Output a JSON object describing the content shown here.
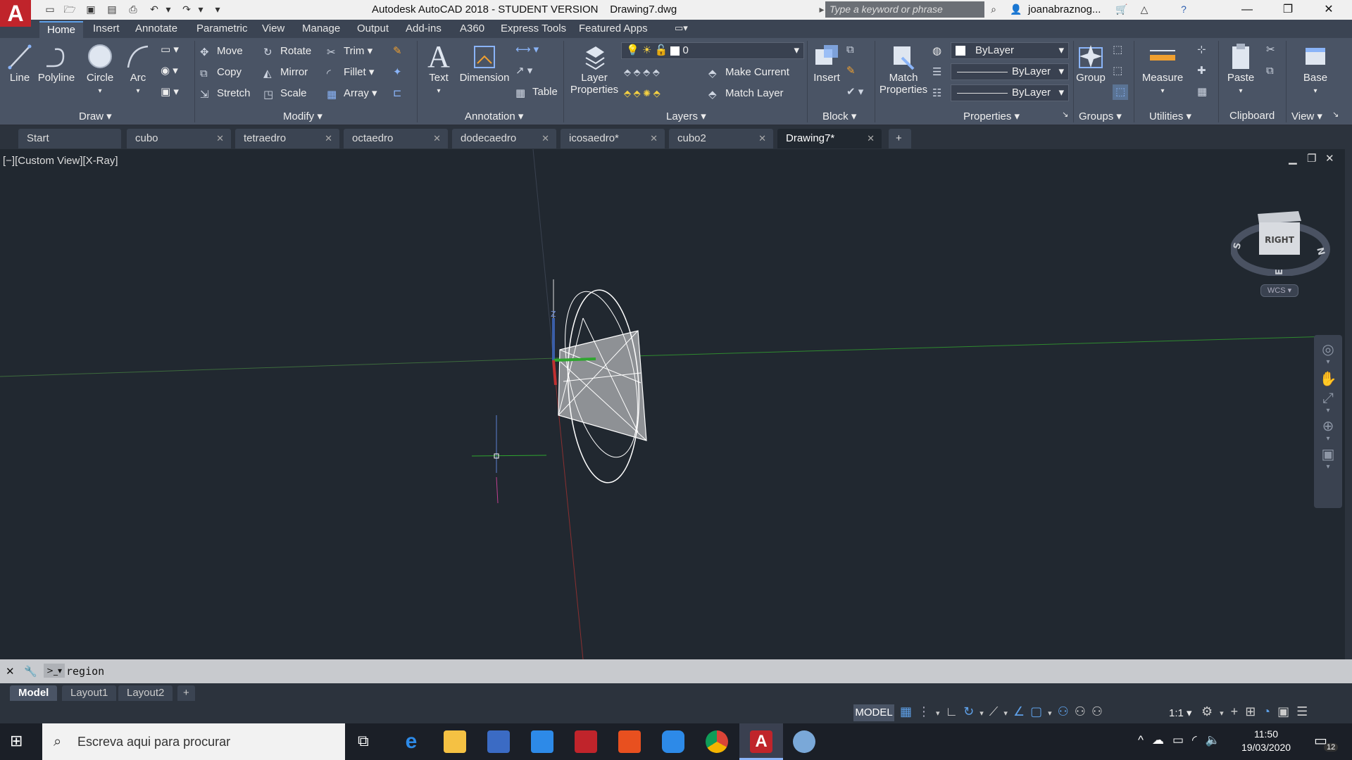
{
  "titlebar": {
    "app_letter": "A",
    "title": "Autodesk AutoCAD 2018 - STUDENT VERSION    Drawing7.dwg",
    "search_placeholder": "Type a keyword or phrase",
    "user": "joanabraznog...",
    "minimize": "—",
    "restore": "❐",
    "close": "✕"
  },
  "ribbon_tabs": [
    "Home",
    "Insert",
    "Annotate",
    "Parametric",
    "View",
    "Manage",
    "Output",
    "Add-ins",
    "A360",
    "Express Tools",
    "Featured Apps"
  ],
  "ribbon": {
    "draw": {
      "title": "Draw",
      "line": "Line",
      "polyline": "Polyline",
      "circle": "Circle",
      "arc": "Arc"
    },
    "modify": {
      "title": "Modify",
      "move": "Move",
      "rotate": "Rotate",
      "trim": "Trim",
      "copy": "Copy",
      "mirror": "Mirror",
      "fillet": "Fillet",
      "stretch": "Stretch",
      "scale": "Scale",
      "array": "Array"
    },
    "annotation": {
      "title": "Annotation",
      "text": "Text",
      "dimension": "Dimension",
      "table": "Table"
    },
    "layers": {
      "title": "Layers",
      "layer_properties_1": "Layer",
      "layer_properties_2": "Properties",
      "current_layer": "0",
      "make_current": "Make Current",
      "match_layer": "Match Layer"
    },
    "block": {
      "title": "Block",
      "insert": "Insert"
    },
    "properties": {
      "title": "Properties",
      "match_1": "Match",
      "match_2": "Properties",
      "color": "ByLayer",
      "linetype": "ByLayer",
      "lineweight": "ByLayer"
    },
    "groups": {
      "title": "Groups",
      "group": "Group"
    },
    "utilities": {
      "title": "Utilities",
      "measure": "Measure"
    },
    "clipboard": {
      "title": "Clipboard",
      "paste": "Paste"
    },
    "view": {
      "title": "View",
      "base": "Base"
    }
  },
  "doc_tabs": [
    "Start",
    "cubo",
    "tetraedro",
    "octaedro",
    "dodecaedro",
    "icosaedro*",
    "cubo2",
    "Drawing7*"
  ],
  "viewport": {
    "label": "[−][Custom View][X-Ray]",
    "viewcube_face": "RIGHT",
    "compass_s": "S",
    "compass_n": "N",
    "compass_e": "E",
    "wcs": "WCS"
  },
  "command": {
    "text": "region"
  },
  "layout_tabs": [
    "Model",
    "Layout1",
    "Layout2"
  ],
  "status": {
    "model": "MODEL",
    "scale": "1:1"
  },
  "taskbar": {
    "search_placeholder": "Escreva aqui para procurar",
    "time": "11:50",
    "date": "19/03/2020",
    "notifications": "12"
  },
  "colors": {
    "accent": "#5ea0e8",
    "autocad_red": "#c0242b",
    "viewport_bg": "#212830",
    "ribbon_bg": "#4a5465"
  }
}
